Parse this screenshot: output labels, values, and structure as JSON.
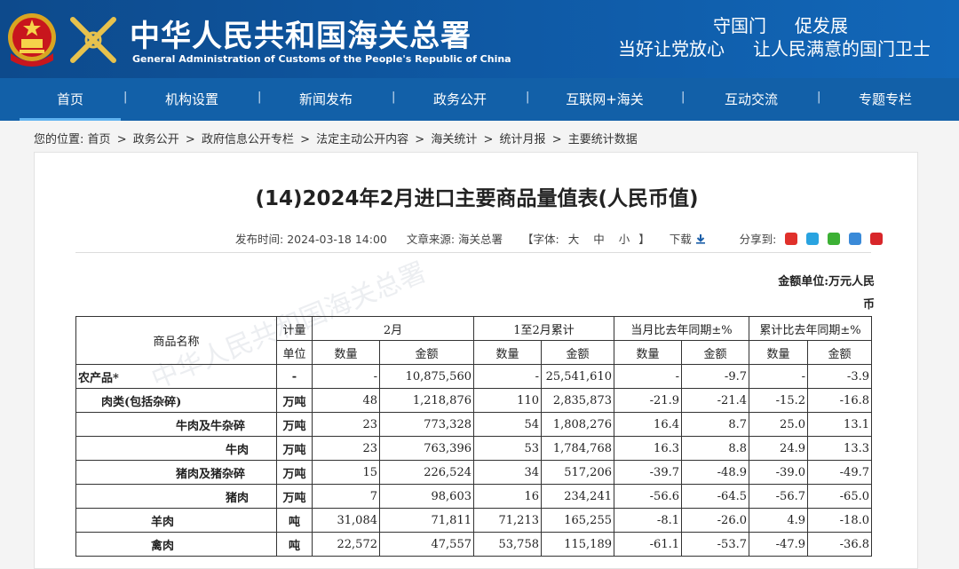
{
  "header": {
    "site_name_cn": "中华人民共和国海关总署",
    "site_name_en": "General Administration of Customs of the People's Republic of China",
    "slogan_top": [
      "守国门",
      "促发展"
    ],
    "slogan_bottom": [
      "当好让党放心",
      "让人民满意的国门卫士"
    ]
  },
  "nav": {
    "items": [
      "首页",
      "机构设置",
      "新闻发布",
      "政务公开",
      "互联网+海关",
      "互动交流",
      "专题专栏"
    ],
    "separator": "|",
    "active_color": "#5fb3f0"
  },
  "breadcrumb": {
    "prefix": "您的位置:",
    "items": [
      "首页",
      "政务公开",
      "政府信息公开专栏",
      "法定主动公开内容",
      "海关统计",
      "统计月报",
      "主要统计数据"
    ],
    "separator": ">"
  },
  "article": {
    "title": "(14)2024年2月进口主要商品量值表(人民币值)",
    "publish_label": "发布时间:",
    "publish_time": "2024-03-18 14:00",
    "source_label": "文章来源:",
    "source": "海关总署",
    "font_label": "【字体:",
    "font_large": "大",
    "font_medium": "中",
    "font_small": "小",
    "font_close": "】",
    "download": "下载",
    "share_label": "分享到:",
    "unit_line1": "金额单位:万元人民",
    "unit_line2": "币"
  },
  "table": {
    "headers": {
      "name": "商品名称",
      "unit_top": "计量",
      "unit_bottom": "单位",
      "feb": "2月",
      "jan_feb": "1至2月累计",
      "month_yoy": "当月比去年同期±%",
      "cum_yoy": "累计比去年同期±%",
      "qty": "数量",
      "amt": "金额"
    },
    "rows": [
      {
        "name": "农产品*",
        "unit": "-",
        "qty": "-",
        "amt": "10,875,560",
        "cqty": "-",
        "camt": "25,541,610",
        "mqty": "-",
        "mamt": "-9.7",
        "cuqty": "-",
        "cuamt": "-3.9"
      },
      {
        "name": "肉类(包括杂碎)",
        "unit": "万吨",
        "qty": "48",
        "amt": "1,218,876",
        "cqty": "110",
        "camt": "2,835,873",
        "mqty": "-21.9",
        "mamt": "-21.4",
        "cuqty": "-15.2",
        "cuamt": "-16.8"
      },
      {
        "name": "牛肉及牛杂碎",
        "unit": "万吨",
        "qty": "23",
        "amt": "773,328",
        "cqty": "54",
        "camt": "1,808,276",
        "mqty": "16.4",
        "mamt": "8.7",
        "cuqty": "25.0",
        "cuamt": "13.1"
      },
      {
        "name": "牛肉",
        "unit": "万吨",
        "qty": "23",
        "amt": "763,396",
        "cqty": "53",
        "camt": "1,784,768",
        "mqty": "16.3",
        "mamt": "8.8",
        "cuqty": "24.9",
        "cuamt": "13.3"
      },
      {
        "name": "猪肉及猪杂碎",
        "unit": "万吨",
        "qty": "15",
        "amt": "226,524",
        "cqty": "34",
        "camt": "517,206",
        "mqty": "-39.7",
        "mamt": "-48.9",
        "cuqty": "-39.0",
        "cuamt": "-49.7"
      },
      {
        "name": "猪肉",
        "unit": "万吨",
        "qty": "7",
        "amt": "98,603",
        "cqty": "16",
        "camt": "234,241",
        "mqty": "-56.6",
        "mamt": "-64.5",
        "cuqty": "-56.7",
        "cuamt": "-65.0"
      },
      {
        "name": "羊肉",
        "unit": "吨",
        "qty": "31,084",
        "amt": "71,811",
        "cqty": "71,213",
        "camt": "165,255",
        "mqty": "-8.1",
        "mamt": "-26.0",
        "cuqty": "4.9",
        "cuamt": "-18.0"
      },
      {
        "name": "禽肉",
        "unit": "吨",
        "qty": "22,572",
        "amt": "47,557",
        "cqty": "53,758",
        "camt": "115,189",
        "mqty": "-61.1",
        "mamt": "-53.7",
        "cuqty": "-47.9",
        "cuamt": "-36.8"
      }
    ]
  }
}
